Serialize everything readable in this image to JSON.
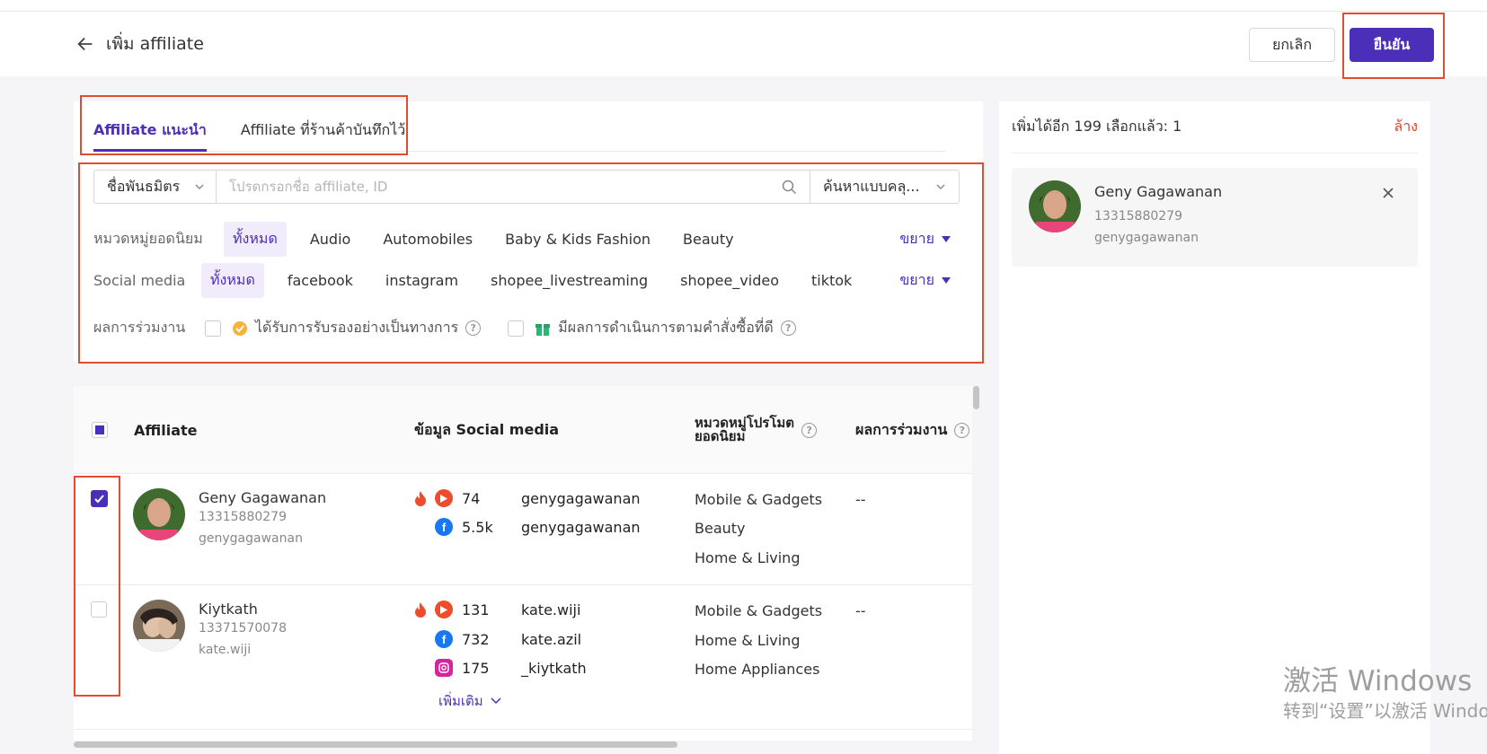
{
  "header": {
    "title": "เพิ่ม affiliate",
    "cancel_label": "ยกเลิก",
    "confirm_label": "ยืนยัน"
  },
  "tabs": [
    {
      "label": "Affiliate แนะนำ",
      "active": true
    },
    {
      "label": "Affiliate ที่ร้านค้าบันทึกไว้",
      "active": false
    }
  ],
  "search": {
    "field_select": "ชื่อพันธมิตร",
    "placeholder": "โปรดกรอกชื่อ affiliate, ID",
    "mode_select": "ค้นหาแบบคลุ..."
  },
  "filters": {
    "category": {
      "label": "หมวดหมู่ยอดนิยม",
      "options": [
        "ทั้งหมด",
        "Audio",
        "Automobiles",
        "Baby & Kids Fashion",
        "Beauty"
      ],
      "expand_label": "ขยาย"
    },
    "social": {
      "label": "Social media",
      "options": [
        "ทั้งหมด",
        "facebook",
        "instagram",
        "shopee_livestreaming",
        "shopee_video",
        "tiktok"
      ],
      "expand_label": "ขยาย"
    },
    "performance": {
      "label": "ผลการร่วมงาน",
      "option1": "ได้รับการรับรองอย่างเป็นทางการ",
      "option2": "มีผลการดำเนินการตามคำสั่งซื้อที่ดี"
    }
  },
  "table": {
    "headers": {
      "affiliate": "Affiliate",
      "social": "ข้อมูล Social media",
      "category_line1": "หมวดหมู่โปรโมต",
      "category_line2": "ยอดนิยม",
      "performance": "ผลการร่วมงาน"
    },
    "rows": [
      {
        "name": "Geny Gagawanan",
        "id": "13315880279",
        "username": "genygagawanan",
        "selected": true,
        "social": [
          {
            "platform": "shopee_video",
            "count": "74",
            "handle": "genygagawanan"
          },
          {
            "platform": "facebook",
            "count": "5.5k",
            "handle": "genygagawanan"
          }
        ],
        "categories": [
          "Mobile & Gadgets",
          "Beauty",
          "Home & Living"
        ],
        "performance": "--"
      },
      {
        "name": "Kiytkath",
        "id": "13371570078",
        "username": "kate.wiji",
        "selected": false,
        "social": [
          {
            "platform": "shopee_video",
            "count": "131",
            "handle": "kate.wiji"
          },
          {
            "platform": "facebook",
            "count": "732",
            "handle": "kate.azil"
          },
          {
            "platform": "instagram",
            "count": "175",
            "handle": "_kiytkath"
          }
        ],
        "more_label": "เพิ่มเติม",
        "categories": [
          "Mobile & Gadgets",
          "Home & Living",
          "Home Appliances"
        ],
        "performance": "--"
      }
    ]
  },
  "side": {
    "summary": "เพิ่มได้อีก 199 เลือกแล้ว: 1",
    "clear_label": "ล้าง",
    "selected": {
      "name": "Geny Gagawanan",
      "id": "13315880279",
      "username": "genygagawanan"
    }
  },
  "watermark": {
    "line1": "激活 Windows",
    "line2": "转到“设置”以激活 Windows。"
  },
  "colors": {
    "accent": "#4c2fb8",
    "highlight_box": "#e54b2f",
    "danger": "#e5412b"
  }
}
